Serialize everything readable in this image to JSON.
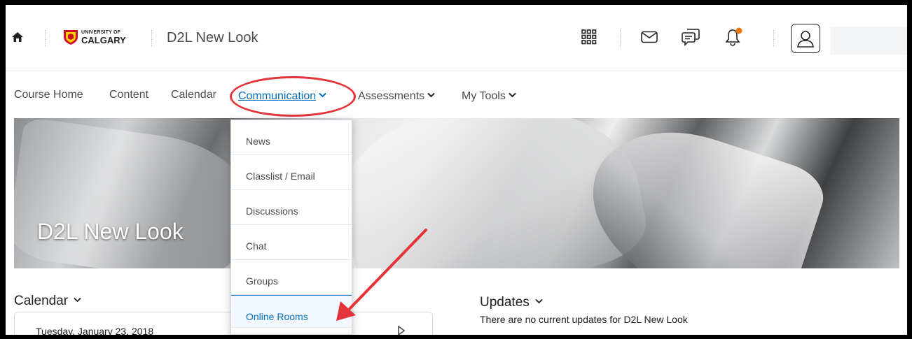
{
  "header": {
    "logo": {
      "line1": "UNIVERSITY OF",
      "line2": "CALGARY"
    },
    "course_title": "D2L New Look"
  },
  "nav": {
    "items": [
      {
        "label": "Course Home"
      },
      {
        "label": "Content"
      },
      {
        "label": "Calendar"
      },
      {
        "label": "Communication",
        "active": true
      },
      {
        "label": "Assessments"
      },
      {
        "label": "My Tools"
      }
    ]
  },
  "banner": {
    "title": "D2L New Look"
  },
  "dropdown": {
    "items": [
      {
        "label": "News"
      },
      {
        "label": "Classlist / Email"
      },
      {
        "label": "Discussions"
      },
      {
        "label": "Chat"
      },
      {
        "label": "Groups"
      },
      {
        "label": "Online Rooms",
        "highlighted": true
      }
    ]
  },
  "calendar_widget": {
    "heading": "Calendar",
    "date": "Tuesday, January 23, 2018"
  },
  "updates_widget": {
    "heading": "Updates",
    "message": "There are no current updates for D2L New Look"
  },
  "colors": {
    "link": "#006fbf",
    "annotation_red": "#e5333a",
    "notification_dot": "#e87511"
  }
}
